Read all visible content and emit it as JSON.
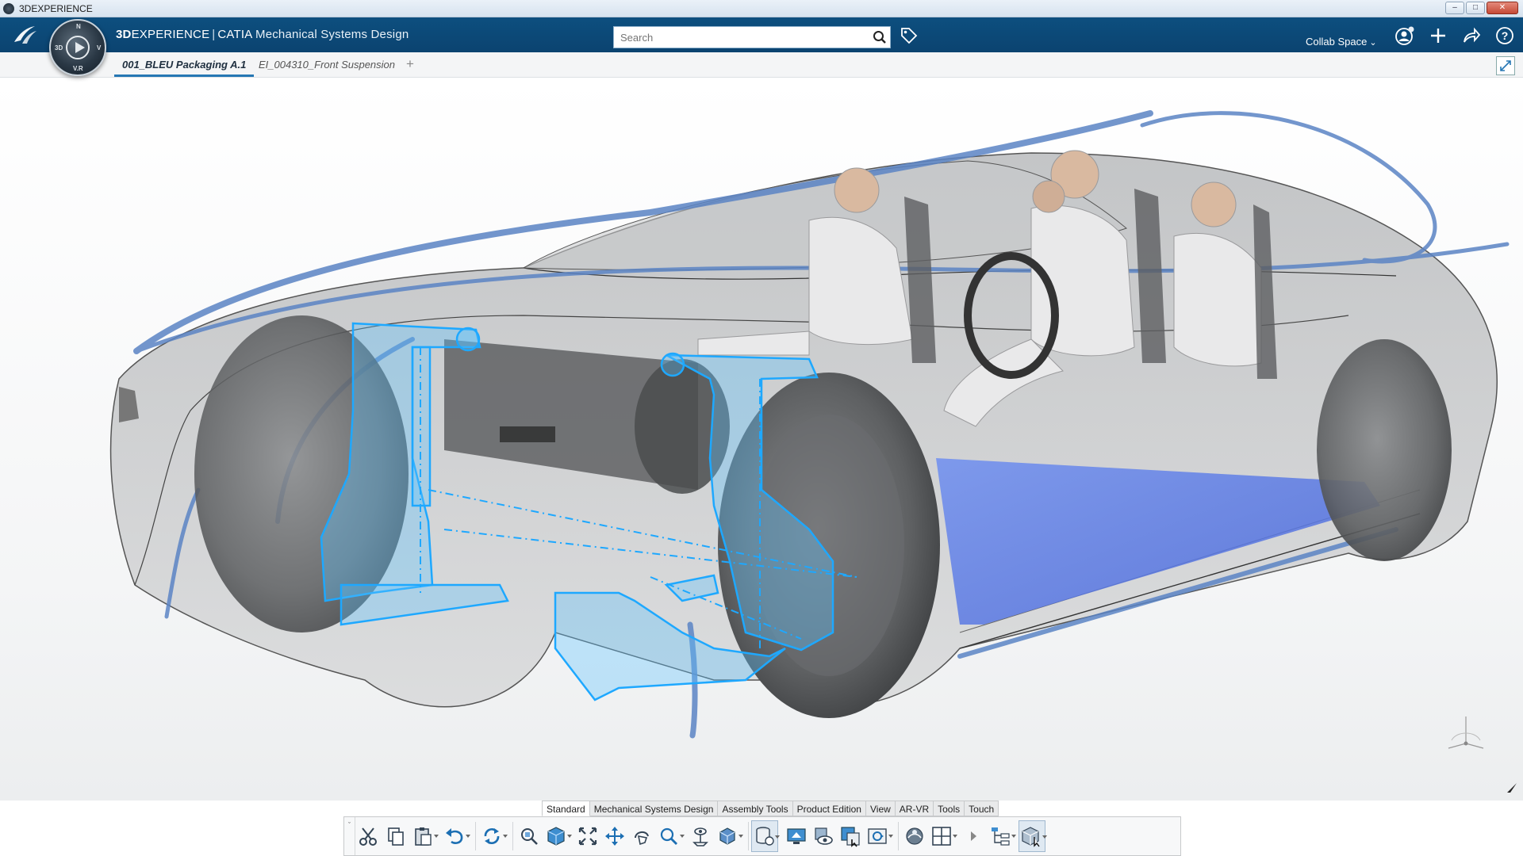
{
  "window": {
    "title": "3DEXPERIENCE",
    "buttons": [
      "–",
      "□",
      "✕"
    ]
  },
  "topbar": {
    "brand_bold": "3D",
    "brand_rest": "EXPERIENCE",
    "brand_sep": "|",
    "app_name": "CATIA",
    "app_role": "Mechanical Systems Design",
    "compass_labels": {
      "top": "N",
      "left": "3D",
      "right": "V",
      "bottom": "V.R"
    },
    "search_placeholder": "Search",
    "collab_space": "Collab Space"
  },
  "tabs": {
    "active": "001_BLEU Packaging A.1",
    "inactive": "EI_004310_Front Suspension",
    "add": "+"
  },
  "actionbar": {
    "tabs": [
      "Standard",
      "Mechanical Systems Design",
      "Assembly Tools",
      "Product Edition",
      "View",
      "AR-VR",
      "Tools",
      "Touch"
    ],
    "active_tab": "Standard",
    "collapse_glyph": "ˇ"
  },
  "colors": {
    "topbar": "#0d4f7f",
    "accent": "#2677b4",
    "highlight": "#1ea8ff",
    "floor": "#5b7fe6",
    "curve": "#5b84c4"
  }
}
